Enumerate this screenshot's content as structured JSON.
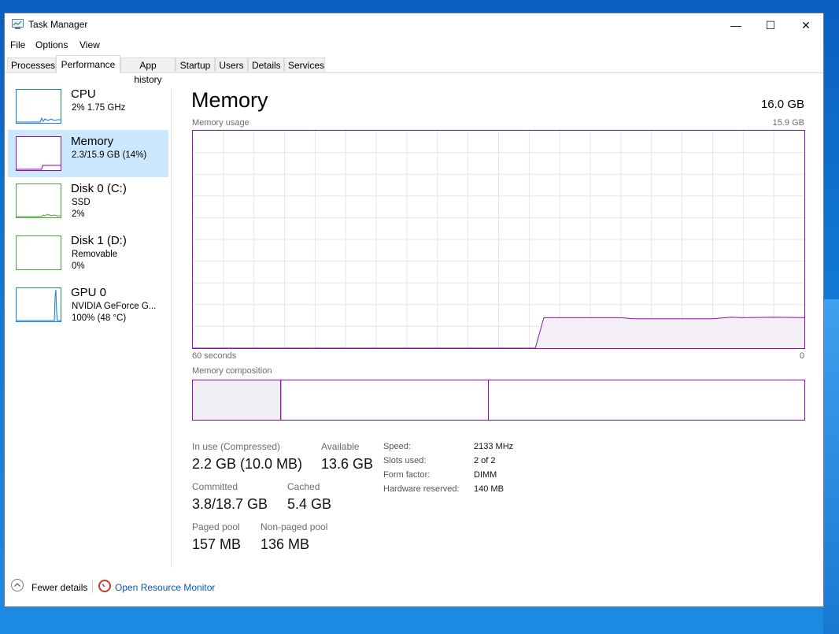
{
  "window": {
    "title": "Task Manager",
    "controls": {
      "minimize": "—",
      "maximize": "☐",
      "close": "✕"
    }
  },
  "menu": [
    "File",
    "Options",
    "View"
  ],
  "tabs": [
    "Processes",
    "Performance",
    "App history",
    "Startup",
    "Users",
    "Details",
    "Services"
  ],
  "active_tab": "Performance",
  "sidebar": {
    "items": [
      {
        "title": "CPU",
        "sub1": "2%  1.75 GHz",
        "sub2": "",
        "icon": "cpu-graph-thumbnail",
        "color": "#1b7ed1"
      },
      {
        "title": "Memory",
        "sub1": "2.3/15.9 GB (14%)",
        "sub2": "",
        "icon": "memory-graph-thumbnail",
        "color": "#8b12ae",
        "selected": true
      },
      {
        "title": "Disk 0 (C:)",
        "sub1": "SSD",
        "sub2": "2%",
        "icon": "disk-graph-thumbnail",
        "color": "#4aa53a"
      },
      {
        "title": "Disk 1 (D:)",
        "sub1": "Removable",
        "sub2": "0%",
        "icon": "disk-graph-thumbnail",
        "color": "#4aa53a"
      },
      {
        "title": "GPU 0",
        "sub1": "NVIDIA GeForce G...",
        "sub2": "100%  (48 °C)",
        "icon": "gpu-graph-thumbnail",
        "color": "#1b7ed1"
      }
    ]
  },
  "main": {
    "title": "Memory",
    "total": "16.0 GB",
    "usage_label": "Memory usage",
    "usage_max": "15.9 GB",
    "axis_left": "60 seconds",
    "axis_right": "0",
    "composition_label": "Memory composition",
    "accent": "#8b12ae",
    "usage_series": [
      [
        0.0,
        0.0
      ],
      [
        0.56,
        0.0
      ],
      [
        0.574,
        0.14
      ],
      [
        0.7,
        0.14
      ],
      [
        0.72,
        0.135
      ],
      [
        0.85,
        0.135
      ],
      [
        0.88,
        0.142
      ],
      [
        0.9,
        0.14
      ],
      [
        0.95,
        0.142
      ],
      [
        1.0,
        0.14
      ]
    ],
    "composition": [
      {
        "name": "in-use",
        "fraction": 0.144,
        "fill": "#f2eff4"
      },
      {
        "name": "modified",
        "fraction": 0.002,
        "fill": "#d9b7e6"
      },
      {
        "name": "standby",
        "fraction": 0.338,
        "fill": "#ffffff"
      },
      {
        "name": "free",
        "fraction": 0.516,
        "fill": "#ffffff"
      }
    ],
    "stats": {
      "in_use_label": "In use (Compressed)",
      "in_use_value": "2.2 GB (10.0 MB)",
      "available_label": "Available",
      "available_value": "13.6 GB",
      "committed_label": "Committed",
      "committed_value": "3.8/18.7 GB",
      "cached_label": "Cached",
      "cached_value": "5.4 GB",
      "paged_label": "Paged pool",
      "paged_value": "157 MB",
      "nonpaged_label": "Non-paged pool",
      "nonpaged_value": "136 MB"
    },
    "specs": {
      "speed_label": "Speed:",
      "speed_value": "2133 MHz",
      "slots_label": "Slots used:",
      "slots_value": "2 of 2",
      "form_label": "Form factor:",
      "form_value": "DIMM",
      "hw_label": "Hardware reserved:",
      "hw_value": "140 MB"
    }
  },
  "footer": {
    "fewer_details": "Fewer details",
    "open_rm": "Open Resource Monitor"
  }
}
